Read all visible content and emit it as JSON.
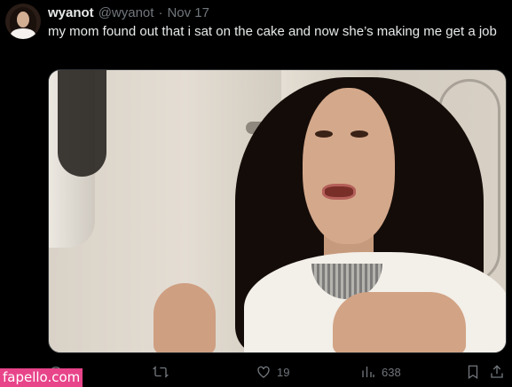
{
  "tweet": {
    "display_name": "wyanot",
    "handle": "@wyanot",
    "separator": "·",
    "date": "Nov 17",
    "text": "my mom found out that i sat on the cake and now she’s making me get a job"
  },
  "actions": {
    "reply_icon": "reply-icon",
    "retweet_icon": "retweet-icon",
    "like_icon": "heart-icon",
    "like_count": "19",
    "views_icon": "bar-chart-icon",
    "views_count": "638",
    "bookmark_icon": "bookmark-icon",
    "share_icon": "share-icon"
  },
  "watermark": "fapello.com",
  "colors": {
    "background": "#000000",
    "text": "#e7e9ea",
    "secondary_text": "#71767b",
    "watermark_bg": "#e8448a"
  }
}
